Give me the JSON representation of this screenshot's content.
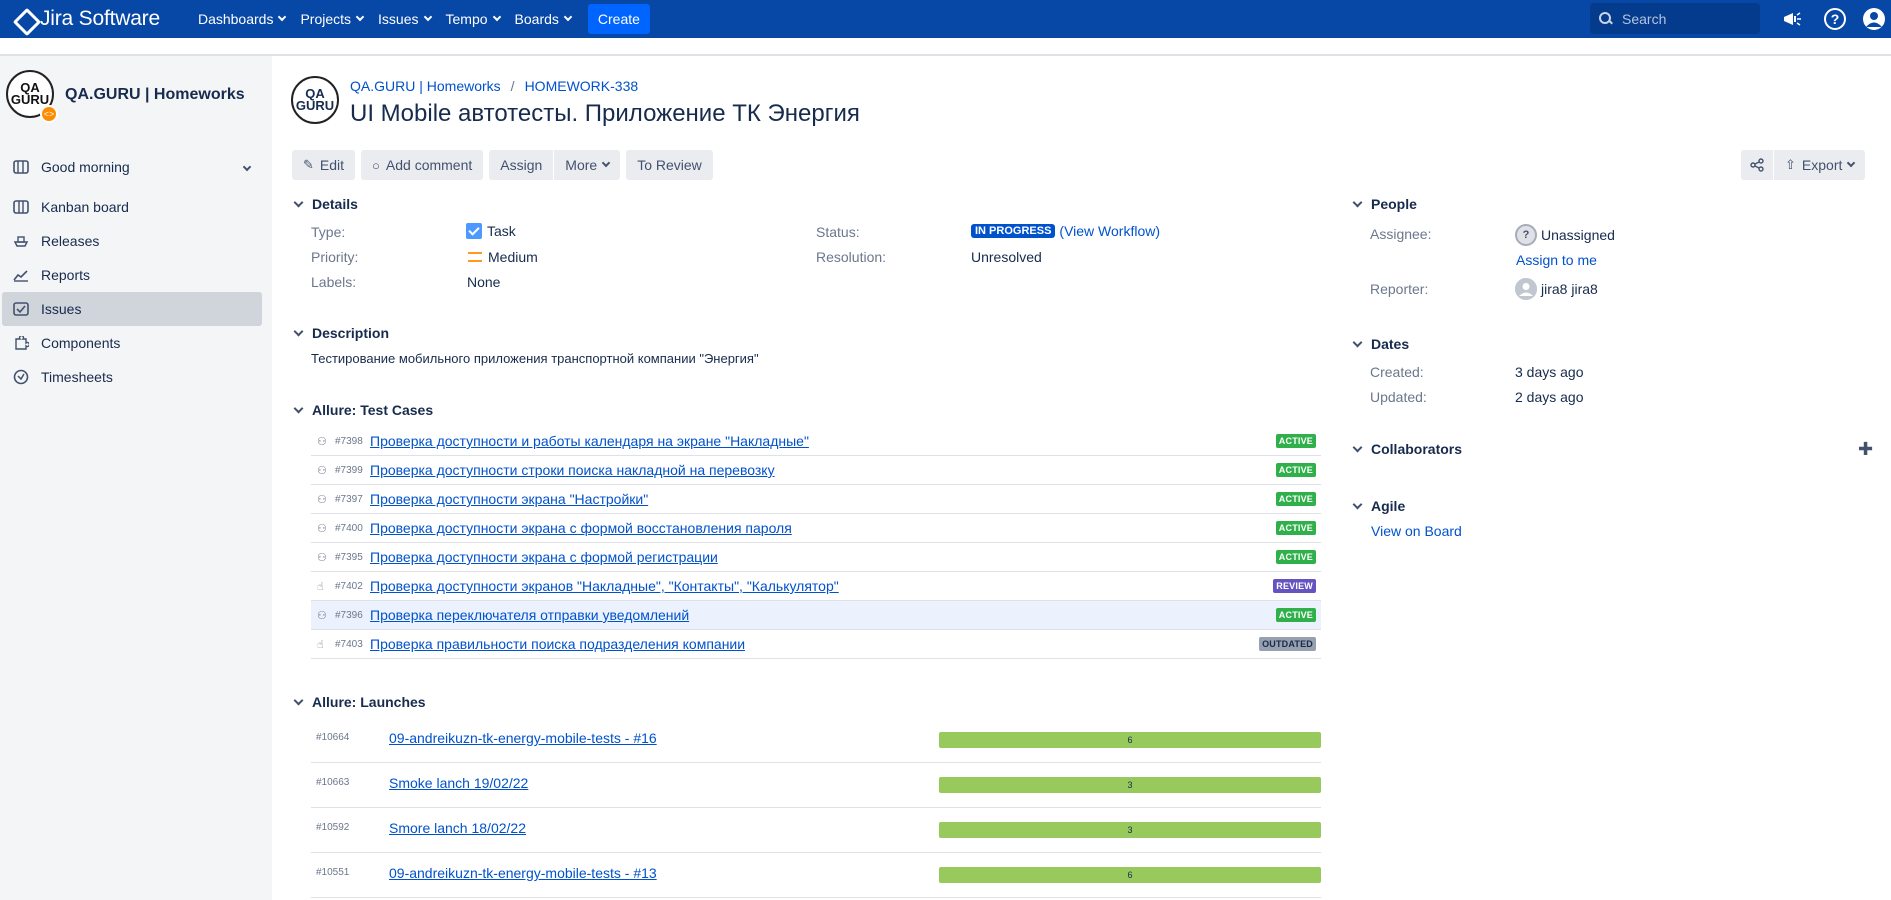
{
  "topnav": {
    "logo": "Jira Software",
    "menus": [
      "Dashboards",
      "Projects",
      "Issues",
      "Tempo",
      "Boards"
    ],
    "create": "Create",
    "search_placeholder": "Search"
  },
  "sidebar": {
    "project_name": "QA.GURU | Homeworks",
    "avatar_text": "QA GURU",
    "items": [
      {
        "label": "Good morning",
        "icon": "calendar-icon"
      },
      {
        "label": "Kanban board",
        "icon": "board-icon"
      },
      {
        "label": "Releases",
        "icon": "ship-icon"
      },
      {
        "label": "Reports",
        "icon": "chart-icon"
      },
      {
        "label": "Issues",
        "icon": "issues-icon"
      },
      {
        "label": "Components",
        "icon": "puzzle-icon"
      },
      {
        "label": "Timesheets",
        "icon": "clock-icon"
      }
    ]
  },
  "issue": {
    "breadcrumb_project": "QA.GURU | Homeworks",
    "breadcrumb_key": "HOMEWORK-338",
    "title": "UI Mobile автотесты. Приложение ТК Энергия"
  },
  "toolbar": {
    "edit": "Edit",
    "add_comment": "Add comment",
    "assign": "Assign",
    "more": "More",
    "to_review": "To Review",
    "export": "Export"
  },
  "details": {
    "heading": "Details",
    "type_label": "Type:",
    "type_value": "Task",
    "priority_label": "Priority:",
    "priority_value": "Medium",
    "labels_label": "Labels:",
    "labels_value": "None",
    "status_label": "Status:",
    "status_value": "IN PROGRESS",
    "view_workflow": "(View Workflow)",
    "resolution_label": "Resolution:",
    "resolution_value": "Unresolved"
  },
  "description": {
    "heading": "Description",
    "text": "Тестирование мобильного приложения транспортной компании \"Энергия\""
  },
  "test_cases": {
    "heading": "Allure: Test Cases",
    "rows": [
      {
        "id": "#7398",
        "title": "Проверка доступности и работы календаря на экране \"Накладные\"",
        "status": "ACTIVE",
        "kind": "auto"
      },
      {
        "id": "#7399",
        "title": "Проверка доступности строки поиска накладной на перевозку",
        "status": "ACTIVE",
        "kind": "auto"
      },
      {
        "id": "#7397",
        "title": "Проверка доступности экрана \"Настройки\"",
        "status": "ACTIVE",
        "kind": "auto"
      },
      {
        "id": "#7400",
        "title": "Проверка доступности экрана с формой восстановления пароля",
        "status": "ACTIVE",
        "kind": "auto"
      },
      {
        "id": "#7395",
        "title": "Проверка доступности экрана с формой регистрации",
        "status": "ACTIVE",
        "kind": "auto"
      },
      {
        "id": "#7402",
        "title": "Проверка доступности экранов \"Накладные\", \"Контакты\", \"Калькулятор\"",
        "status": "REVIEW",
        "kind": "manual"
      },
      {
        "id": "#7396",
        "title": "Проверка переключателя отправки уведомлений",
        "status": "ACTIVE",
        "kind": "auto"
      },
      {
        "id": "#7403",
        "title": "Проверка правильности поиска подразделения компании",
        "status": "OUTDATED",
        "kind": "manual"
      }
    ]
  },
  "launches": {
    "heading": "Allure: Launches",
    "rows": [
      {
        "id": "#10664",
        "title": "09-andreikuzn-tk-energy-mobile-tests - #16",
        "count": "6"
      },
      {
        "id": "#10663",
        "title": "Smoke lanch 19/02/22",
        "count": "3"
      },
      {
        "id": "#10592",
        "title": "Smore lanch 18/02/22",
        "count": "3"
      },
      {
        "id": "#10551",
        "title": "09-andreikuzn-tk-energy-mobile-tests - #13",
        "count": "6"
      }
    ]
  },
  "people": {
    "heading": "People",
    "assignee_label": "Assignee:",
    "assignee_value": "Unassigned",
    "assign_to_me": "Assign to me",
    "reporter_label": "Reporter:",
    "reporter_value": "jira8 jira8"
  },
  "dates": {
    "heading": "Dates",
    "created_label": "Created:",
    "created_value": "3 days ago",
    "updated_label": "Updated:",
    "updated_value": "2 days ago"
  },
  "collaborators": {
    "heading": "Collaborators"
  },
  "agile": {
    "heading": "Agile",
    "view_on_board": "View on Board"
  },
  "colors": {
    "nav": "#0747a6",
    "link": "#0052cc",
    "active": "#2fb04a",
    "review": "#6554c0",
    "launch_bar": "#97c95c"
  }
}
